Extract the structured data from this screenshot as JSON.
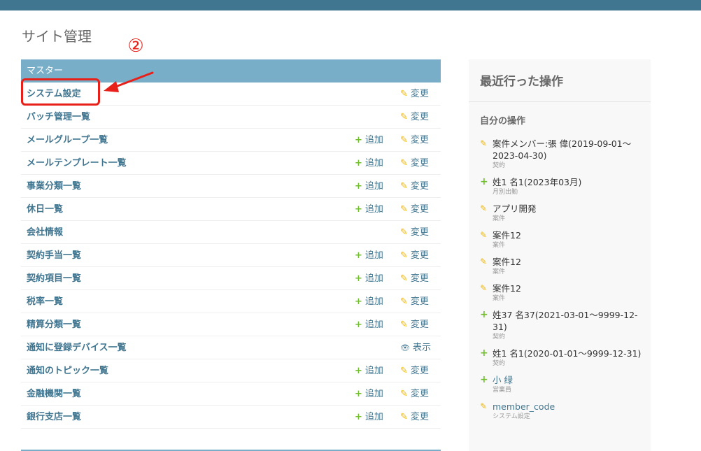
{
  "page": {
    "title": "サイト管理"
  },
  "annotation": {
    "number": "②"
  },
  "module": {
    "caption": "マスター",
    "rows": [
      {
        "name": "システム設定",
        "add": "",
        "change": "変更",
        "change_icon": "pencil-icon"
      },
      {
        "name": "バッチ管理一覧",
        "add": "",
        "change": "変更",
        "change_icon": "pencil-icon"
      },
      {
        "name": "メールグループ一覧",
        "add": "追加",
        "change": "変更",
        "change_icon": "pencil-icon"
      },
      {
        "name": "メールテンプレート一覧",
        "add": "追加",
        "change": "変更",
        "change_icon": "pencil-icon"
      },
      {
        "name": "事業分類一覧",
        "add": "追加",
        "change": "変更",
        "change_icon": "pencil-icon"
      },
      {
        "name": "休日一覧",
        "add": "追加",
        "change": "変更",
        "change_icon": "pencil-icon"
      },
      {
        "name": "会社情報",
        "add": "",
        "change": "変更",
        "change_icon": "pencil-icon"
      },
      {
        "name": "契約手当一覧",
        "add": "追加",
        "change": "変更",
        "change_icon": "pencil-icon"
      },
      {
        "name": "契約項目一覧",
        "add": "追加",
        "change": "変更",
        "change_icon": "pencil-icon"
      },
      {
        "name": "税率一覧",
        "add": "追加",
        "change": "変更",
        "change_icon": "pencil-icon"
      },
      {
        "name": "精算分類一覧",
        "add": "追加",
        "change": "変更",
        "change_icon": "pencil-icon"
      },
      {
        "name": "通知に登録デバイス一覧",
        "add": "",
        "change": "表示",
        "change_icon": "eye-icon"
      },
      {
        "name": "通知のトピック一覧",
        "add": "追加",
        "change": "変更",
        "change_icon": "pencil-icon"
      },
      {
        "name": "金融機関一覧",
        "add": "追加",
        "change": "変更",
        "change_icon": "pencil-icon"
      },
      {
        "name": "銀行支店一覧",
        "add": "追加",
        "change": "変更",
        "change_icon": "pencil-icon"
      }
    ]
  },
  "recent": {
    "title": "最近行った操作",
    "subtitle": "自分の操作",
    "items": [
      {
        "icon": "pencil-icon",
        "text": "案件メンバー:張 偉(2019-09-01～2023-04-30)",
        "type": "契約"
      },
      {
        "icon": "plus-icon",
        "text": "姓1 名1(2023年03月)",
        "type": "月別出勤"
      },
      {
        "icon": "pencil-icon",
        "text": "アプリ開発",
        "type": "案件"
      },
      {
        "icon": "pencil-icon",
        "text": "案件12",
        "type": "案件"
      },
      {
        "icon": "pencil-icon",
        "text": "案件12",
        "type": "案件"
      },
      {
        "icon": "pencil-icon",
        "text": "案件12",
        "type": "案件"
      },
      {
        "icon": "plus-icon",
        "text": "姓37 名37(2021-03-01～9999-12-31)",
        "type": "契約"
      },
      {
        "icon": "plus-icon",
        "text": "姓1 名1(2020-01-01～9999-12-31)",
        "type": "契約"
      },
      {
        "icon": "plus-icon",
        "text": "小 绿",
        "type": "営業員",
        "link": true
      },
      {
        "icon": "pencil-icon",
        "text": "member_code",
        "type": "システム設定",
        "link": true
      }
    ]
  }
}
